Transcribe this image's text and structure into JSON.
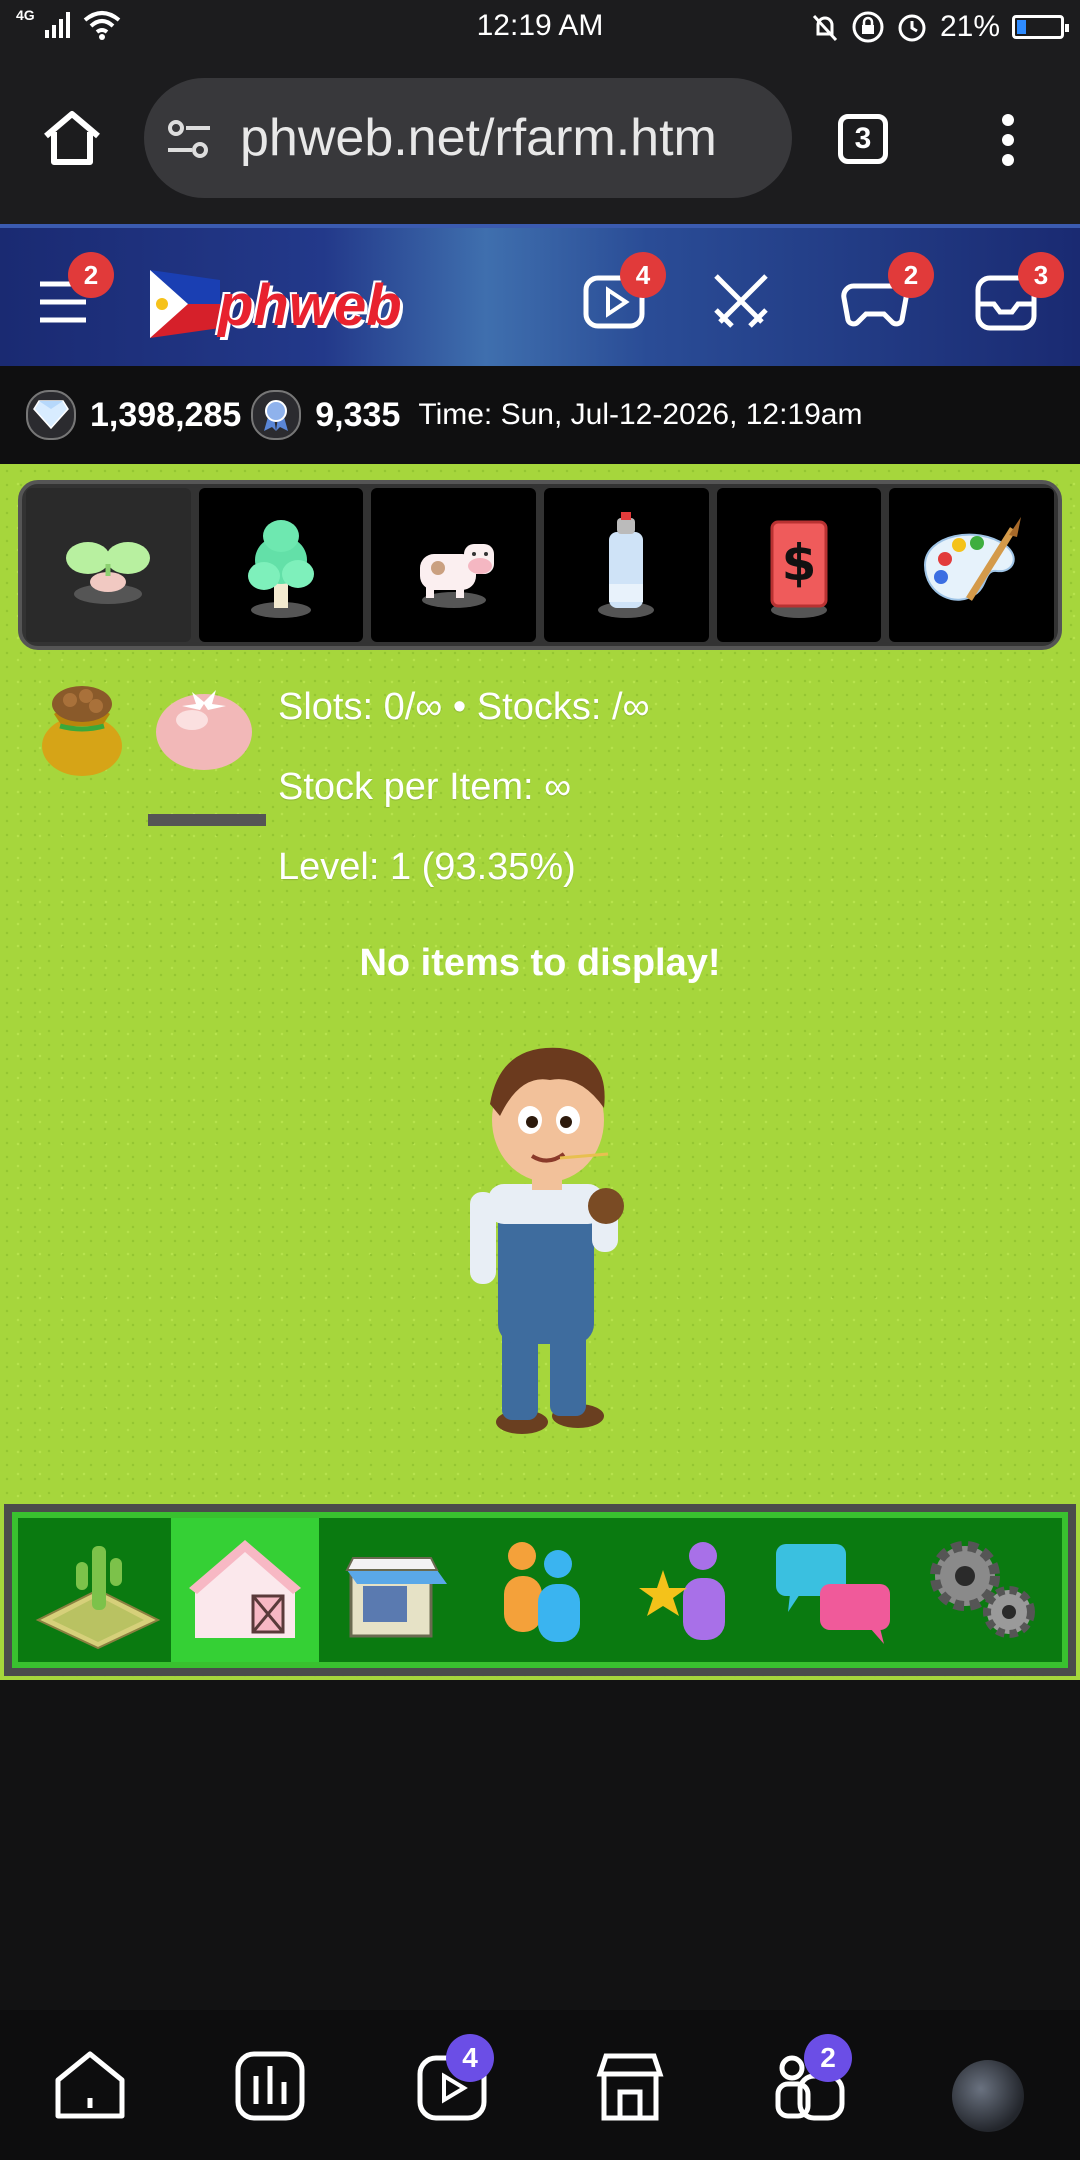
{
  "status_bar": {
    "network": "4G",
    "time": "12:19 AM",
    "battery": "21%",
    "battery_level": 0.21
  },
  "browser": {
    "url": "phweb.net/rfarm.htm",
    "tab_count": "3",
    "icons": [
      "home-icon",
      "site-settings-icon",
      "tabs-icon",
      "more-vert-icon"
    ]
  },
  "site_header": {
    "logo": "phweb",
    "menu_badge": "2",
    "video_badge": "4",
    "battle_badge": "",
    "games_badge": "2",
    "inbox_badge": "3"
  },
  "stats": {
    "diamonds": "1,398,285",
    "ribbons": "9,335",
    "time": "Time: Sun, Jul-12-2026, 12:19am"
  },
  "category_tabs": [
    {
      "name": "seedling",
      "active": true
    },
    {
      "name": "tree",
      "active": false
    },
    {
      "name": "cow",
      "active": false
    },
    {
      "name": "spray-can",
      "active": false
    },
    {
      "name": "dollar-card",
      "active": false
    },
    {
      "name": "palette",
      "active": false
    }
  ],
  "storage": {
    "slots": "Slots: 0/∞ • Stocks: /∞",
    "stock_per_item": "Stock per Item: ∞",
    "level": "Level: 1 (93.35%)",
    "empty_message": "No items to display!"
  },
  "bottom_menu": [
    {
      "name": "farm-plot",
      "active": false
    },
    {
      "name": "barn",
      "active": true
    },
    {
      "name": "shop",
      "active": false
    },
    {
      "name": "friends",
      "active": false
    },
    {
      "name": "favorites",
      "active": false
    },
    {
      "name": "chat",
      "active": false
    },
    {
      "name": "settings",
      "active": false
    }
  ],
  "nav": {
    "video_badge": "4",
    "groups_badge": "2"
  },
  "colors": {
    "grass": "#a6d63c",
    "menu_green": "#0a7a10",
    "menu_active": "#35d035",
    "badge_red": "#e13a3a",
    "badge_purple": "#6b4ee6"
  }
}
